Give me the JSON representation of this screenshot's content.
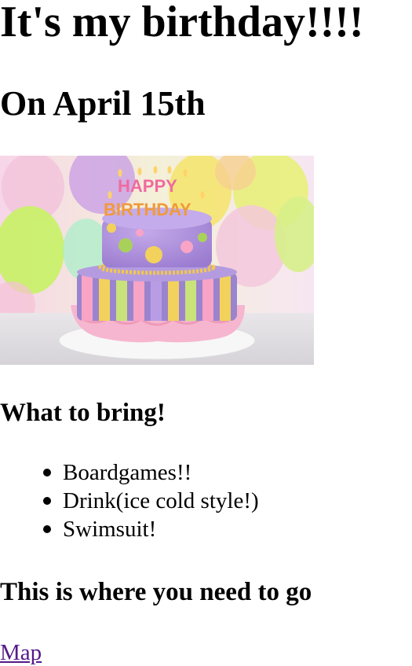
{
  "heading": "It's my birthday!!!!",
  "date": "On April 15th",
  "image": {
    "topper_line1": "HAPPY",
    "topper_line2": "BIRTHDAY"
  },
  "bring": {
    "title": "What to bring!",
    "items": [
      "Boardgames!!",
      "Drink(ice cold style!)",
      "Swimsuit!"
    ]
  },
  "where": {
    "title": "This is where you need to go",
    "link_label": "Map"
  },
  "colors": {
    "link": "#551a8b",
    "text": "#000000"
  }
}
